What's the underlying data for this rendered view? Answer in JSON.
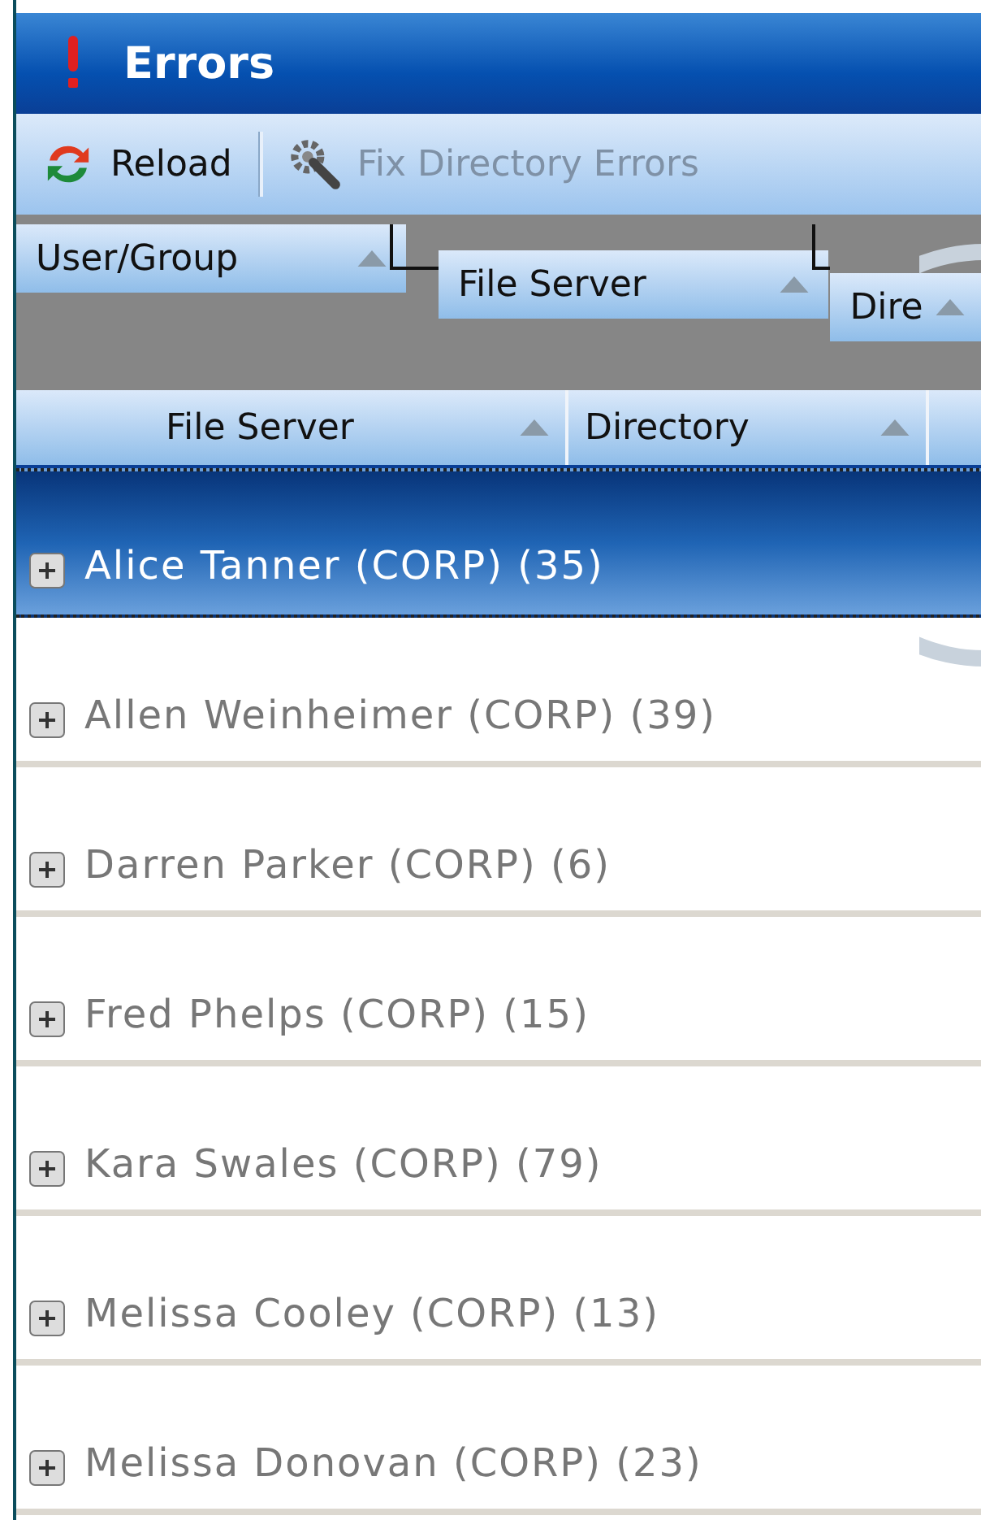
{
  "window": {
    "title": "Errors"
  },
  "toolbar": [
    {
      "label": "Reload",
      "kind": "reload",
      "disabled": false
    },
    {
      "label": "Fix Directory Errors",
      "kind": "fix",
      "disabled": true
    }
  ],
  "group_by": [
    "User/Group",
    "File Server",
    "Dire"
  ],
  "columns": [
    "File Server",
    "Directory"
  ],
  "rows": [
    {
      "label": "Alice Tanner (CORP) (35)",
      "selected": true,
      "expanded": false
    },
    {
      "label": "Allen Weinheimer (CORP) (39)",
      "selected": false,
      "expanded": false
    },
    {
      "label": "Darren Parker (CORP) (6)",
      "selected": false,
      "expanded": false
    },
    {
      "label": "Fred Phelps (CORP) (15)",
      "selected": false,
      "expanded": false
    },
    {
      "label": "Kara Swales (CORP) (79)",
      "selected": false,
      "expanded": false
    },
    {
      "label": "Melissa Cooley (CORP) (13)",
      "selected": false,
      "expanded": false
    },
    {
      "label": "Melissa Donovan (CORP) (23)",
      "selected": false,
      "expanded": false
    }
  ]
}
